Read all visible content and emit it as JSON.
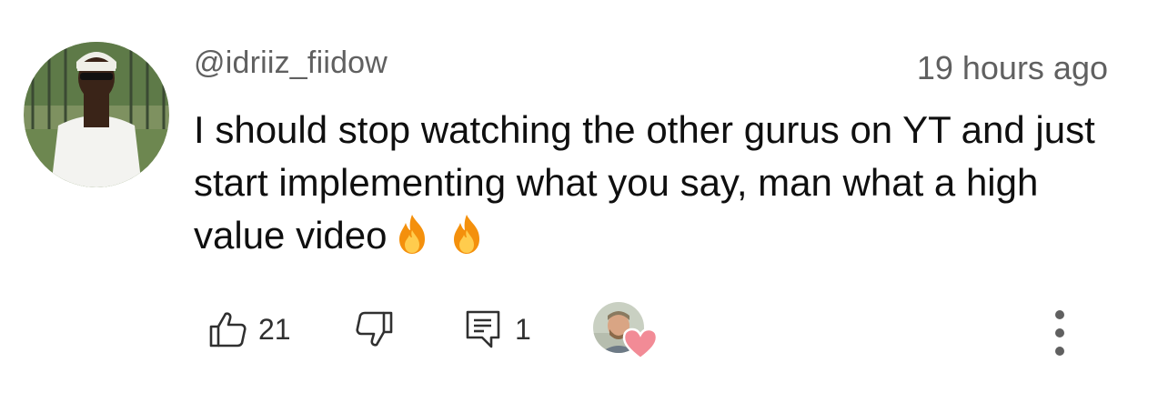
{
  "comment": {
    "author": "@idriiz_fiidow",
    "timestamp": "19 hours ago",
    "text": "I should stop watching the other gurus on YT and just start implementing what you say, man what a high value video",
    "emojis": [
      "fire",
      "fire"
    ],
    "likes": "21",
    "replies": "1",
    "creator_hearted": true
  },
  "colors": {
    "text_primary": "#0f0f0f",
    "text_secondary": "#606060",
    "heart": "#f28b96"
  },
  "icons": {
    "like": "thumbs-up-icon",
    "dislike": "thumbs-down-icon",
    "reply": "reply-comment-icon",
    "more": "more-vertical-icon",
    "emoji": "fire-emoji"
  }
}
